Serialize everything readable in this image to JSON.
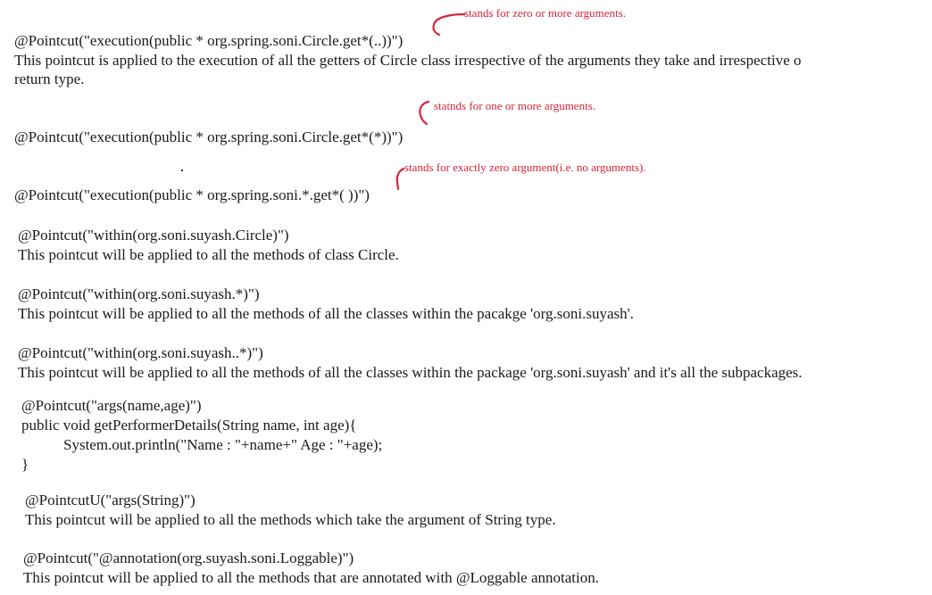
{
  "blocks": {
    "exec_getters": {
      "code": "@Pointcut(\"execution(public * org.spring.soni.Circle.get*(..))\")",
      "desc_line1": "This pointcut is applied to the execution of all the getters of Circle class irrespective of the arguments they take and irrespective o",
      "desc_line2": "return type.",
      "note": "stands for zero or more arguments."
    },
    "exec_one_arg": {
      "code": "@Pointcut(\"execution(public * org.spring.soni.Circle.get*(*))\")",
      "note": "statnds for one or more arguments."
    },
    "exec_no_arg": {
      "code": "@Pointcut(\"execution(public * org.spring.soni.*.get*( ))\")",
      "note": "stands for exactly zero argument(i.e. no arguments)."
    },
    "within_class": {
      "code": "@Pointcut(\"within(org.soni.suyash.Circle)\")",
      "desc": "This pointcut will be applied to all the methods of class Circle."
    },
    "within_package": {
      "code": "@Pointcut(\"within(org.soni.suyash.*)\")",
      "desc": "This pointcut will be applied to all the methods of all the classes within the pacakge 'org.soni.suyash'."
    },
    "within_subpackages": {
      "code": "@Pointcut(\"within(org.soni.suyash..*)\")",
      "desc": "This pointcut will be applied to all the methods of all the classes within the package 'org.soni.suyash' and it's all the subpackages."
    },
    "args_example": {
      "line1": "@Pointcut(\"args(name,age)\")",
      "line2": "public void getPerformerDetails(String name, int age){",
      "line3": "System.out.println(\"Name : \"+name+\" Age : \"+age);",
      "line4": "}"
    },
    "args_string": {
      "code": "@PointcutU(\"args(String)\")",
      "desc": "This pointcut will be applied to all the methods which take the argument of String type."
    },
    "annotation": {
      "code": "@Pointcut(\"@annotation(org.suyash.soni.Loggable)\")",
      "desc": "This pointcut will be applied to all the methods that are annotated with @Loggable annotation."
    }
  },
  "colors": {
    "text": "#1a1a1a",
    "annotation": "#d8233a"
  }
}
